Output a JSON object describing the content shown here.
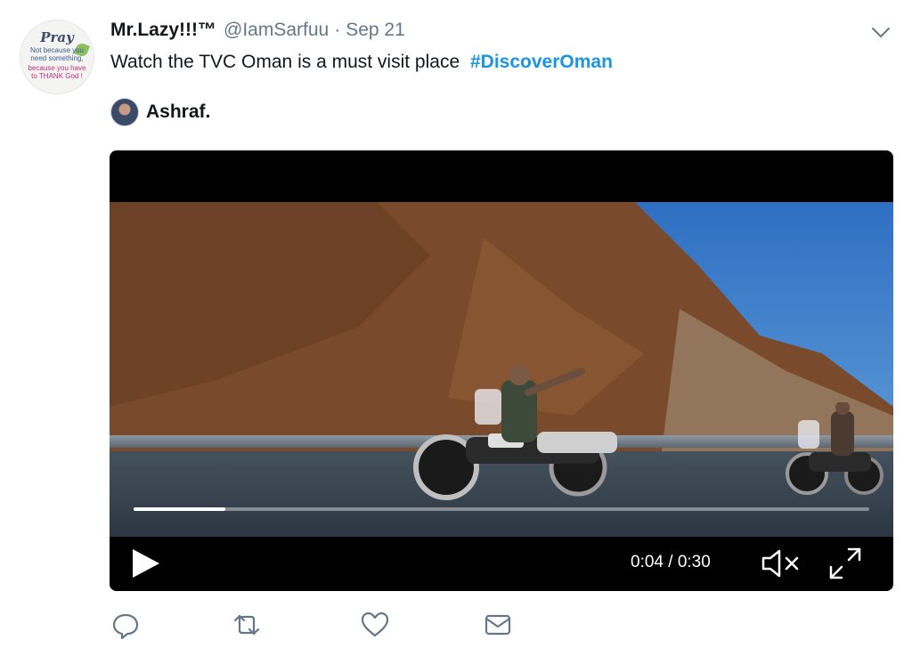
{
  "tweet": {
    "author": {
      "name": "Mr.Lazy!!!™",
      "handle": "@IamSarfuu",
      "avatar_text": {
        "title": "Pray",
        "line1": "Not because you",
        "line2": "need something,",
        "line3": "because you have",
        "line4": "to THANK God !"
      }
    },
    "separator": "·",
    "date": "Sep 21",
    "text": "Watch the TVC Oman is a must visit place",
    "hashtag": "#DiscoverOman",
    "mention": {
      "name": "Ashraf."
    }
  },
  "video": {
    "current_time": "0:04",
    "duration": "0:30",
    "time_label": "0:04 / 0:30",
    "progress": 0.125,
    "muted": true
  },
  "icons": {
    "menu": "chevron-down-icon",
    "play": "play-icon",
    "mute": "speaker-muted-icon",
    "fullscreen": "expand-icon",
    "reply": "reply-icon",
    "retweet": "retweet-icon",
    "like": "heart-icon",
    "message": "envelope-icon"
  },
  "colors": {
    "hashtag": "#1b95e0",
    "secondary_text": "#657786",
    "action_icon": "#657786"
  }
}
